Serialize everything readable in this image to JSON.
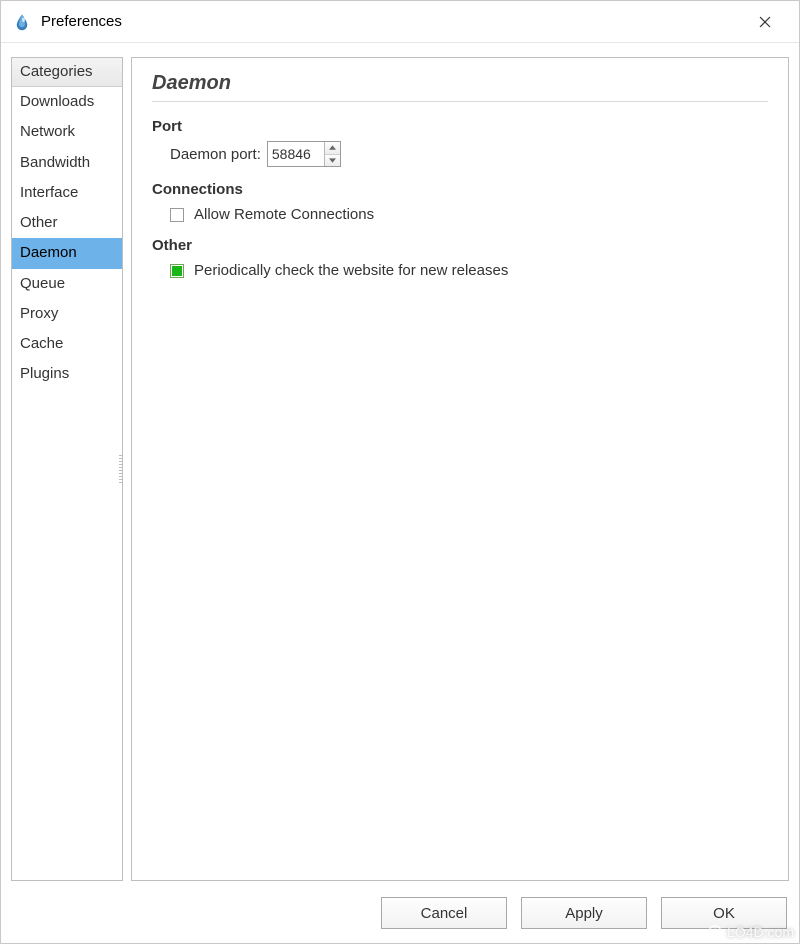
{
  "window": {
    "title": "Preferences"
  },
  "sidebar": {
    "header": "Categories",
    "items": [
      {
        "label": "Downloads",
        "selected": false
      },
      {
        "label": "Network",
        "selected": false
      },
      {
        "label": "Bandwidth",
        "selected": false
      },
      {
        "label": "Interface",
        "selected": false
      },
      {
        "label": "Other",
        "selected": false
      },
      {
        "label": "Daemon",
        "selected": true
      },
      {
        "label": "Queue",
        "selected": false
      },
      {
        "label": "Proxy",
        "selected": false
      },
      {
        "label": "Cache",
        "selected": false
      },
      {
        "label": "Plugins",
        "selected": false
      }
    ]
  },
  "panel": {
    "title": "Daemon",
    "port_section": "Port",
    "port_label": "Daemon port:",
    "port_value": "58846",
    "connections_section": "Connections",
    "allow_remote_label": "Allow Remote Connections",
    "allow_remote_checked": false,
    "other_section": "Other",
    "check_releases_label": "Periodically check the website for new releases",
    "check_releases_checked": true
  },
  "buttons": {
    "cancel": "Cancel",
    "apply": "Apply",
    "ok": "OK"
  },
  "watermark": "LO4D.com"
}
